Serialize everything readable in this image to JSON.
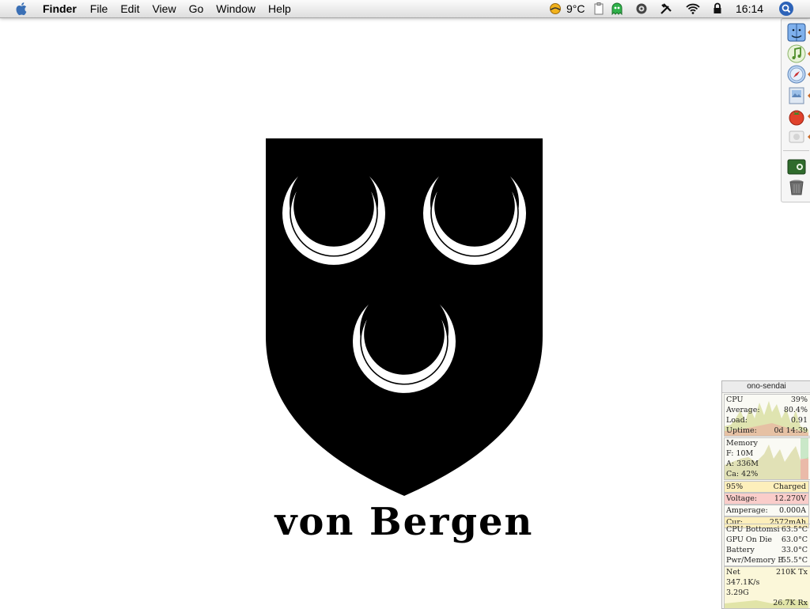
{
  "menubar": {
    "app_name": "Finder",
    "menus": [
      "File",
      "Edit",
      "View",
      "Go",
      "Window",
      "Help"
    ],
    "weather_temp": "9°C",
    "clock": "16:14"
  },
  "dock": {
    "items": [
      "finder",
      "itunes",
      "safari",
      "preview",
      "tomato",
      "app",
      "photo",
      "trash"
    ]
  },
  "arms": {
    "motto": "von Bergen",
    "field_color": "#000000",
    "charge_color": "#ffffff"
  },
  "monitor": {
    "host": "ono-sendai",
    "cpu": {
      "label": "CPU",
      "value": "39%",
      "average_label": "Average:",
      "average": "80.4%",
      "load_label": "Load:",
      "load": "0.91",
      "uptime_label": "Uptime:",
      "uptime": "0d 14:39"
    },
    "memory": {
      "label": "Memory",
      "free": "F: 10M",
      "active": "A: 336M",
      "cache": "Ca: 42%"
    },
    "battery": {
      "percent": "95%",
      "state": "Charged",
      "voltage_label": "Voltage:",
      "voltage": "12.270V",
      "amperage_label": "Amperage:",
      "amperage": "0.000A",
      "cur_label": "Cur:",
      "cur": "2572mAh"
    },
    "temps": [
      {
        "label": "CPU Bottomsi",
        "value": "63.5°C"
      },
      {
        "label": "GPU On Die",
        "value": "63.0°C"
      },
      {
        "label": "Battery",
        "value": "33.0°C"
      },
      {
        "label": "Pwr/Memory B",
        "value": "55.5°C"
      }
    ],
    "net": {
      "label": "Net",
      "tx": "210K Tx",
      "rate": "347.1K/s",
      "total": "3.29G",
      "rx": "26.7K Rx"
    }
  }
}
